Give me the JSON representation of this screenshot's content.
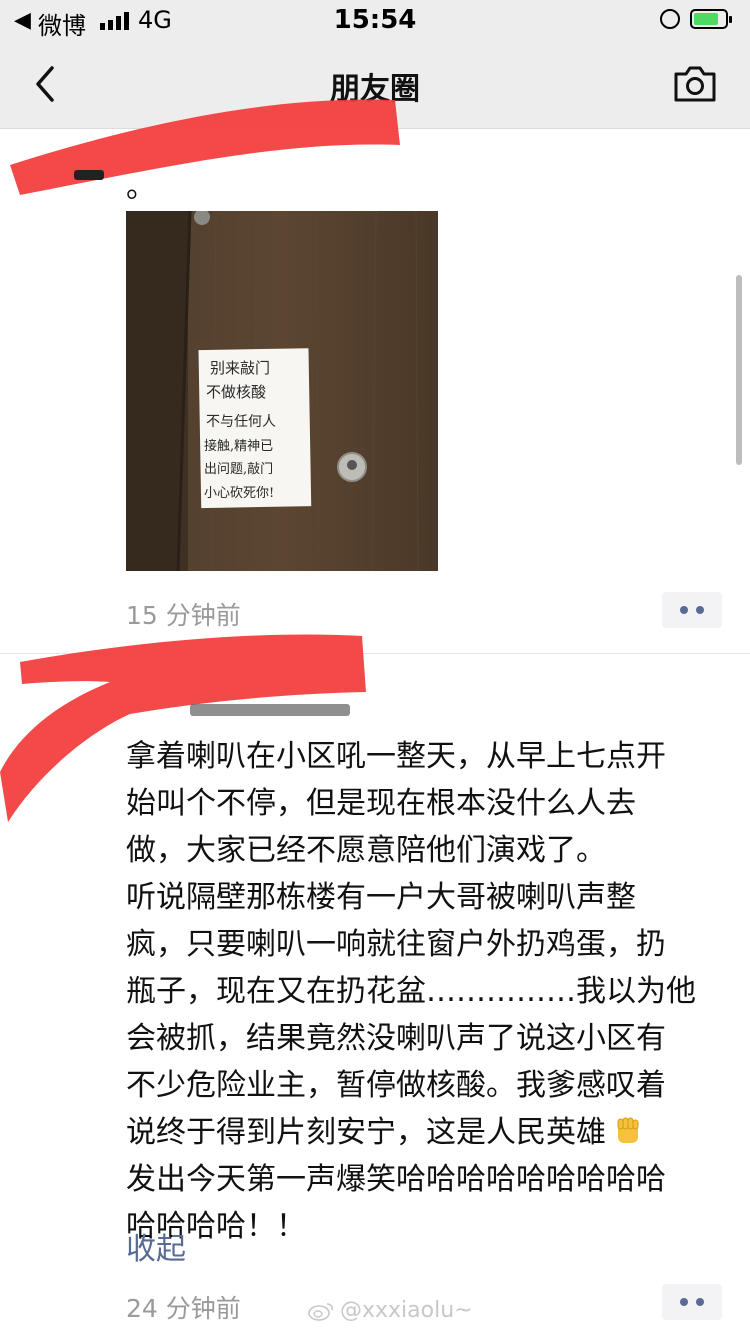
{
  "status_bar": {
    "back_app": "微博",
    "network": "4G",
    "time": "15:54",
    "battery_color": "#4cd964"
  },
  "nav": {
    "title": "朋友圈",
    "back_icon": "chevron-left-icon",
    "camera_icon": "camera-icon"
  },
  "posts": [
    {
      "visible_text_tail": "。",
      "image": "door-with-handwritten-note",
      "note_lines": [
        "别来敲门",
        "不做核酸",
        "不与任何人",
        "接触,精神已",
        "出问题,敲门",
        "小心砍死你!"
      ],
      "time": "15 分钟前"
    },
    {
      "text_lines": [
        "拿着喇叭在小区吼一整天，从早上七点开",
        "始叫个不停，但是现在根本没什么人去",
        "做，大家已经不愿意陪他们演戏了。",
        "听说隔壁那栋楼有一户大哥被喇叭声整",
        "疯，只要喇叭一响就往窗户外扔鸡蛋，扔",
        "瓶子，现在又在扔花盆……………我以为他",
        "会被抓，结果竟然没喇叭声了说这小区有",
        "不少危险业主，暂停做核酸。我爹感叹着",
        "说终于得到片刻安宁，这是人民英雄",
        "发出今天第一声爆笑哈哈哈哈哈哈哈哈哈",
        "哈哈哈哈！！"
      ],
      "collapse_label": "收起",
      "time": "24 分钟前"
    }
  ],
  "watermark": "@xxxiaolu~",
  "colors": {
    "link_blue": "#576b95",
    "redaction_red": "#f23a3a",
    "timestamp_gray": "#9a9a9a"
  }
}
